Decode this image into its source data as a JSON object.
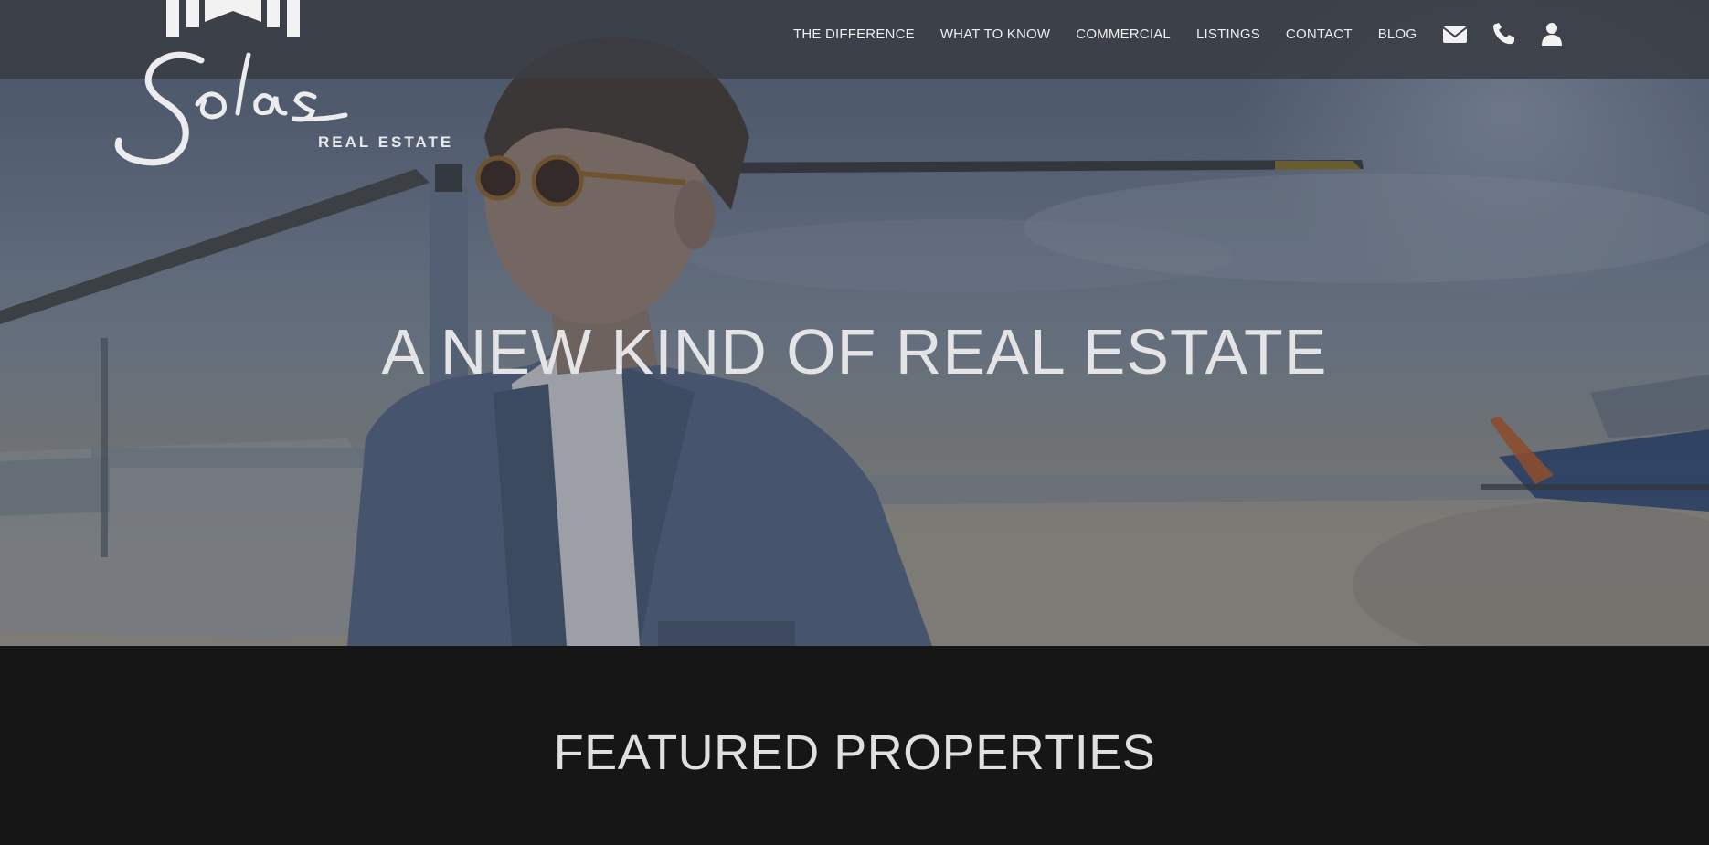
{
  "brand": {
    "logo_script": "Solas",
    "logo_subtitle": "REAL ESTATE"
  },
  "nav": {
    "items": [
      {
        "label": "THE DIFFERENCE"
      },
      {
        "label": "WHAT TO KNOW"
      },
      {
        "label": "COMMERCIAL"
      },
      {
        "label": "LISTINGS"
      },
      {
        "label": "CONTACT"
      },
      {
        "label": "BLOG"
      }
    ],
    "icons": [
      "envelope-icon",
      "phone-icon",
      "user-icon"
    ]
  },
  "hero": {
    "headline": "A NEW KIND OF REAL ESTATE"
  },
  "featured": {
    "heading": "FEATURED PROPERTIES"
  },
  "colors": {
    "header_bg": "#3a3e44",
    "text_light": "#eeeeee",
    "section_dark": "#161616"
  }
}
